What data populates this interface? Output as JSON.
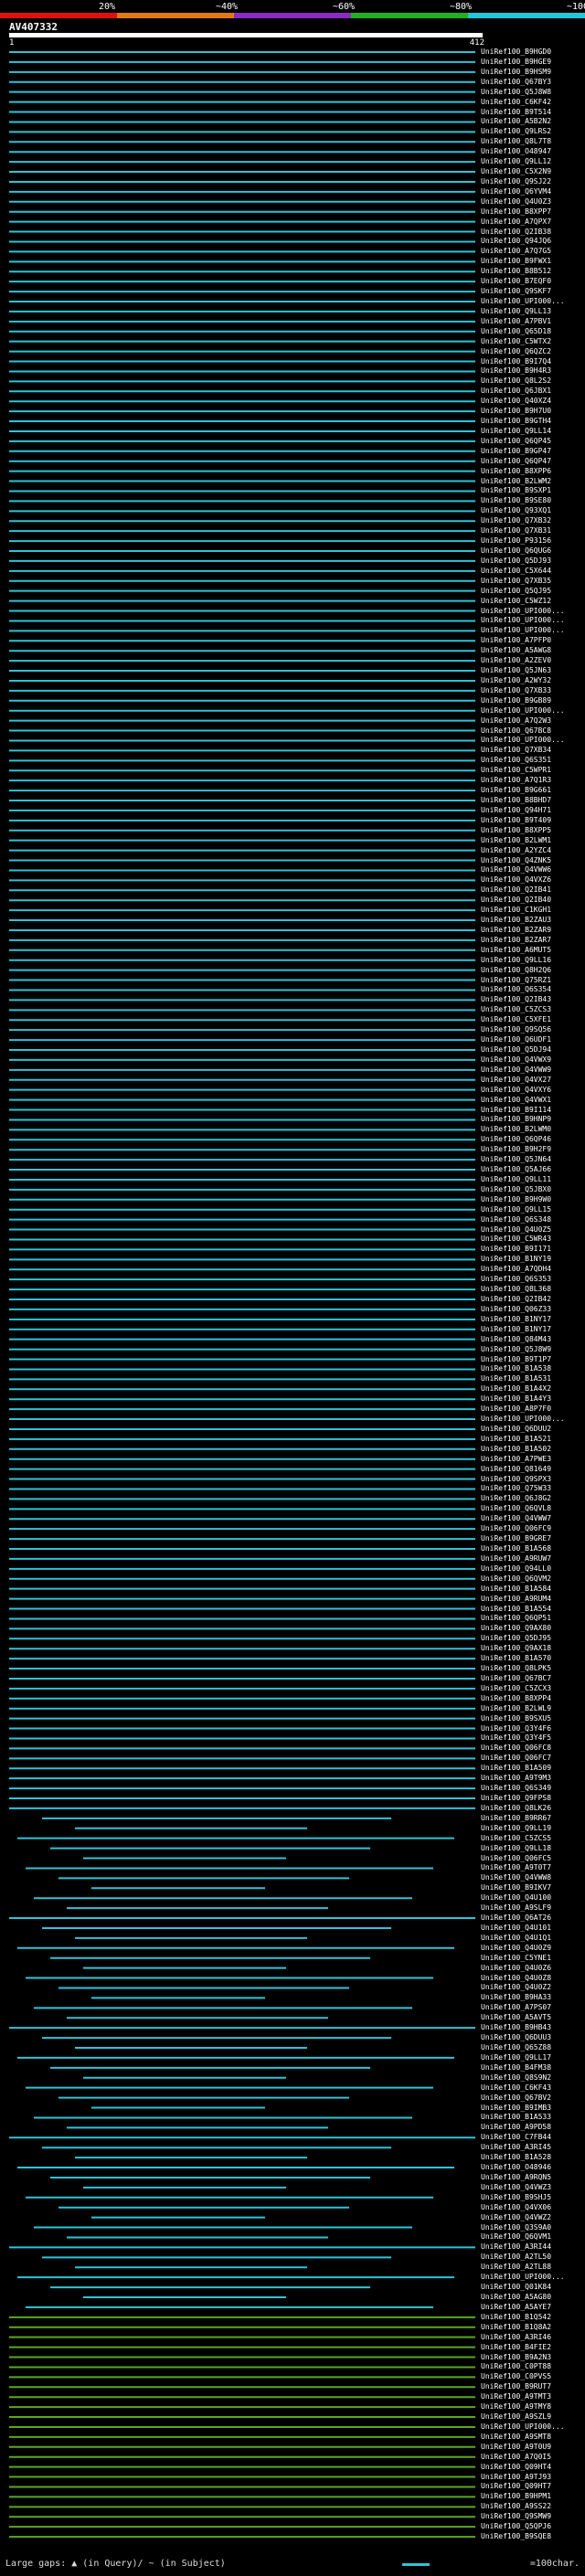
{
  "scale": {
    "labels": [
      "20%",
      "~40%",
      "~60%",
      "~80%",
      "~100%"
    ],
    "colors": [
      "#e01010",
      "#e07a10",
      "#8a2cc4",
      "#20b020",
      "#20c8d8"
    ]
  },
  "query": {
    "title": "AV407332",
    "start": "1",
    "end": "412"
  },
  "colors": {
    "hit_primary": "#2ec4d8",
    "hit_secondary": "#5aa820",
    "marker": "#ffffff"
  },
  "hits": [
    "UniRef100_B9HGD0",
    "UniRef100_B9HGE9",
    "UniRef100_B9HSM9",
    "UniRef100_Q67BY3",
    "UniRef100_Q5J8W8",
    "UniRef100_C6KF42",
    "UniRef100_B9T514",
    "UniRef100_A5B2N2",
    "UniRef100_Q9LRS2",
    "UniRef100_Q8L7T8",
    "UniRef100_O48947",
    "UniRef100_Q9LL12",
    "UniRef100_C5X2N9",
    "UniRef100_Q9SJ22",
    "UniRef100_Q6YVM4",
    "UniRef100_Q4U0Z3",
    "UniRef100_B8XPP7",
    "UniRef100_A7QPX7",
    "UniRef100_Q2IB38",
    "UniRef100_Q94JQ6",
    "UniRef100_A7Q7G5",
    "UniRef100_B9FWX1",
    "UniRef100_B8B512",
    "UniRef100_B7EQF0",
    "UniRef100_Q9SKF7",
    "UniRef100_UPI000...",
    "UniRef100_Q9LL13",
    "UniRef100_A7PBV1",
    "UniRef100_Q65D18",
    "UniRef100_C5WTX2",
    "UniRef100_Q6QZC2",
    "UniRef100_B9I7Q4",
    "UniRef100_B9H4R3",
    "UniRef100_Q8L2S2",
    "UniRef100_Q6JBX1",
    "UniRef100_Q40XZ4",
    "UniRef100_B9H7U0",
    "UniRef100_B9GTH4",
    "UniRef100_Q9LL14",
    "UniRef100_Q6QP45",
    "UniRef100_B9GP47",
    "UniRef100_Q6QP47",
    "UniRef100_B8XPP6",
    "UniRef100_B2LWM2",
    "UniRef100_B9SXP1",
    "UniRef100_B9SE80",
    "UniRef100_Q93XQ1",
    "UniRef100_Q7XB32",
    "UniRef100_Q7XB31",
    "UniRef100_P93156",
    "UniRef100_Q6QUG6",
    "UniRef100_Q5DJ93",
    "UniRef100_C5X644",
    "UniRef100_Q7XB35",
    "UniRef100_Q5QJ95",
    "UniRef100_C5WZ12",
    "UniRef100_UPI000...",
    "UniRef100_UPI000...",
    "UniRef100_UPI000...",
    "UniRef100_A7PFP0",
    "UniRef100_A5AWG8",
    "UniRef100_A2ZEV0",
    "UniRef100_Q5JN63",
    "UniRef100_A2WY32",
    "UniRef100_Q7XB33",
    "UniRef100_B9GB89",
    "UniRef100_UPI000...",
    "UniRef100_A7Q2W3",
    "UniRef100_Q67BC8",
    "UniRef100_UPI000...",
    "UniRef100_Q7XB34",
    "UniRef100_Q6S351",
    "UniRef100_C5WPR1",
    "UniRef100_A7Q1R3",
    "UniRef100_B9G661",
    "UniRef100_B8BHD7",
    "UniRef100_Q94H71",
    "UniRef100_B9T409",
    "UniRef100_B8XPP5",
    "UniRef100_B2LWM1",
    "UniRef100_A2YZC4",
    "UniRef100_Q4ZNK5",
    "UniRef100_Q4VWW6",
    "UniRef100_Q4VXZ6",
    "UniRef100_Q2IB41",
    "UniRef100_Q2IB40",
    "UniRef100_C1KGH1",
    "UniRef100_B2ZAU3",
    "UniRef100_B2ZAR9",
    "UniRef100_B2ZAR7",
    "UniRef100_A6MUT5",
    "UniRef100_Q9LL16",
    "UniRef100_Q8H2Q6",
    "UniRef100_Q75RZ1",
    "UniRef100_Q6S354",
    "UniRef100_Q2IB43",
    "UniRef100_C5ZCS3",
    "UniRef100_C5XFE1",
    "UniRef100_Q9SQ56",
    "UniRef100_Q6UDF1",
    "UniRef100_Q5DJ94",
    "UniRef100_Q4VWX9",
    "UniRef100_Q4VWW9",
    "UniRef100_Q4VX27",
    "UniRef100_Q4VXY6",
    "UniRef100_Q4VWX1",
    "UniRef100_B9I114",
    "UniRef100_B9HNP9",
    "UniRef100_B2LWM0",
    "UniRef100_Q6QP46",
    "UniRef100_B9H2F9",
    "UniRef100_Q5JN64",
    "UniRef100_Q5AJ66",
    "UniRef100_Q9LL11",
    "UniRef100_Q5JBX0",
    "UniRef100_B9H9W0",
    "UniRef100_Q9LL15",
    "UniRef100_Q6S348",
    "UniRef100_Q4U0Z5",
    "UniRef100_C5WR43",
    "UniRef100_B9I171",
    "UniRef100_B1NY19",
    "UniRef100_A7QDH4",
    "UniRef100_Q6S353",
    "UniRef100_Q8L368",
    "UniRef100_Q2IB42",
    "UniRef100_Q06Z33",
    "UniRef100_B1NY17",
    "UniRef100_B1NY17",
    "UniRef100_Q84M43",
    "UniRef100_Q5J8W9",
    "UniRef100_B9T1P7",
    "UniRef100_B1A538",
    "UniRef100_B1A531",
    "UniRef100_B1A4X2",
    "UniRef100_B1A4Y3",
    "UniRef100_A8P7F0",
    "UniRef100_UPI000...",
    "UniRef100_Q6DUU2",
    "UniRef100_B1A521",
    "UniRef100_B1A502",
    "UniRef100_A7PWE3",
    "UniRef100_Q81649",
    "UniRef100_Q9SPX3",
    "UniRef100_Q75W33",
    "UniRef100_Q6J8G2",
    "UniRef100_Q6QVL8",
    "UniRef100_Q4VWW7",
    "UniRef100_Q06FC9",
    "UniRef100_B9GRE7",
    "UniRef100_B1A568",
    "UniRef100_A9RUW7",
    "UniRef100_Q94LL0",
    "UniRef100_Q6QVM2",
    "UniRef100_B1A584",
    "UniRef100_A9RUM4",
    "UniRef100_B1A554",
    "UniRef100_Q6QP51",
    "UniRef100_Q9AX80",
    "UniRef100_Q5DJ95",
    "UniRef100_Q9AX18",
    "UniRef100_B1A570",
    "UniRef100_Q8LPK5",
    "UniRef100_Q67BC7",
    "UniRef100_C5ZCX3",
    "UniRef100_B8XPP4",
    "UniRef100_B2LWL9",
    "UniRef100_B9SXU5",
    "UniRef100_Q3Y4F6",
    "UniRef100_Q3Y4F5",
    "UniRef100_Q06FC8",
    "UniRef100_Q06FC7",
    "UniRef100_B1A509",
    "UniRef100_A9T9M3",
    "UniRef100_Q6S349",
    "UniRef100_Q9FPS8",
    "UniRef100_Q8LK26",
    "UniRef100_B9RR67",
    "UniRef100_Q9LL19",
    "UniRef100_C5ZCS5",
    "UniRef100_Q9LL18",
    "UniRef100_Q06FC5",
    "UniRef100_A9T0T7",
    "UniRef100_Q4VWW8",
    "UniRef100_B9IKV7",
    "UniRef100_Q4U100",
    "UniRef100_A9SLF9",
    "UniRef100_Q6AT26",
    "UniRef100_Q4U101",
    "UniRef100_Q4U1Q1",
    "UniRef100_Q4U0Z9",
    "UniRef100_C5YNE1",
    "UniRef100_Q4U0Z6",
    "UniRef100_Q4U0Z8",
    "UniRef100_Q4U0Z2",
    "UniRef100_B9HA33",
    "UniRef100_A7PS07",
    "UniRef100_A5AVT5",
    "UniRef100_B9HB43",
    "UniRef100_Q6DUU3",
    "UniRef100_Q65Z88",
    "UniRef100_Q9LL17",
    "UniRef100_B4FM38",
    "UniRef100_Q8S9N2",
    "UniRef100_C6KF43",
    "UniRef100_Q67BV2",
    "UniRef100_B9IMB3",
    "UniRef100_B1A533",
    "UniRef100_A9PD58",
    "UniRef100_C7FB44",
    "UniRef100_A3RI45",
    "UniRef100_B1A528",
    "UniRef100_O48946",
    "UniRef100_A9RQN5",
    "UniRef100_Q4VWZ3",
    "UniRef100_B9SHJ5",
    "UniRef100_Q4VX06",
    "UniRef100_Q4VWZ2",
    "UniRef100_Q3S9A0",
    "UniRef100_Q6QVM1",
    "UniRef100_A3RI44",
    "UniRef100_A2TL50",
    "UniRef100_A2TL88",
    "UniRef100_UPI000...",
    "UniRef100_Q01K84",
    "UniRef100_A5AG80",
    "UniRef100_A5AYE7",
    "UniRef100_B1Q542",
    "UniRef100_B1Q8A2",
    "UniRef100_A3RI46",
    "UniRef100_B4FIE2",
    "UniRef100_B9A2N3",
    "UniRef100_C0PT88",
    "UniRef100_C0PVS5",
    "UniRef100_B9RUT7",
    "UniRef100_A9TMT3",
    "UniRef100_A9TMY8",
    "UniRef100_A9SZL9",
    "UniRef100_UPI000...",
    "UniRef100_A9SMT8",
    "UniRef100_A9T0U9",
    "UniRef100_A7Q0I5",
    "UniRef100_Q09HT4",
    "UniRef100_A9TJ93",
    "UniRef100_Q09HT7",
    "UniRef100_B9HPM1",
    "UniRef100_A9SS22",
    "UniRef100_Q9SMW9",
    "UniRef100_Q5QPJ6",
    "UniRef100_B9SQE8"
  ],
  "legend": {
    "gap_text": "Large gaps: ▲ (in Query)/ ~ (in Subject)",
    "scale_text": "=100char."
  }
}
